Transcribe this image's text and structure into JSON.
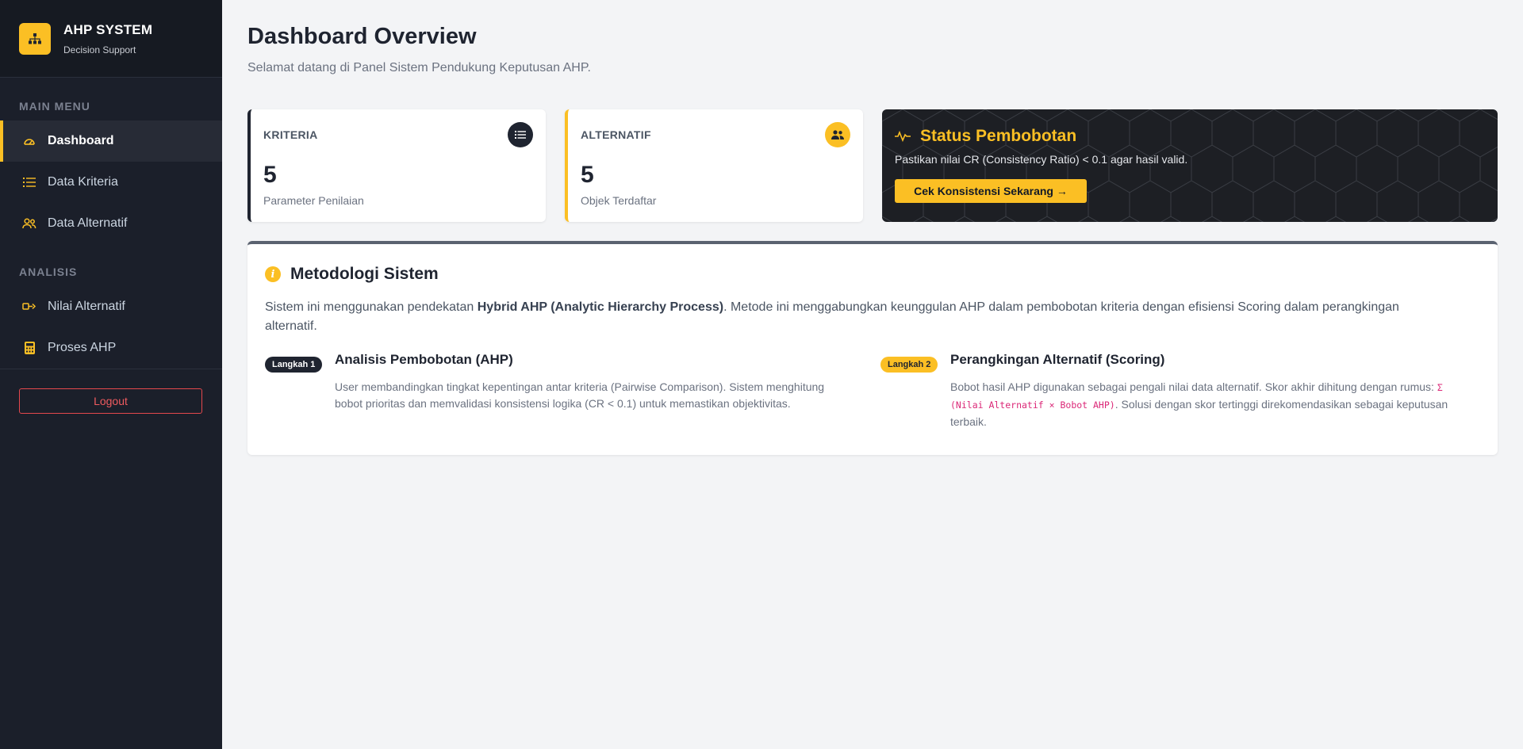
{
  "brand": {
    "title": "AHP SYSTEM",
    "subtitle": "Decision Support"
  },
  "sidebar": {
    "main_menu_heading": "MAIN MENU",
    "analysis_heading": "ANALISIS",
    "items": [
      {
        "label": "Dashboard",
        "icon": "gauge-icon",
        "active": true
      },
      {
        "label": "Data Kriteria",
        "icon": "list-icon",
        "active": false
      },
      {
        "label": "Data Alternatif",
        "icon": "users-icon",
        "active": false
      },
      {
        "label": "Nilai Alternatif",
        "icon": "scale-icon",
        "active": false
      },
      {
        "label": "Proses AHP",
        "icon": "calculator-icon",
        "active": false
      }
    ],
    "logout_label": "Logout"
  },
  "header": {
    "title": "Dashboard Overview",
    "subtitle": "Selamat datang di Panel Sistem Pendukung Keputusan AHP."
  },
  "cards": {
    "kriteria": {
      "label": "KRITERIA",
      "value": "5",
      "desc": "Parameter Penilaian",
      "icon": "list-icon"
    },
    "alternatif": {
      "label": "ALTERNATIF",
      "value": "5",
      "desc": "Objek Terdaftar",
      "icon": "users-icon"
    }
  },
  "status": {
    "title": "Status Pembobotan",
    "text": "Pastikan nilai CR (Consistency Ratio) < 0.1 agar hasil valid.",
    "button_label": "Cek Konsistensi Sekarang →",
    "icon": "pulse-icon"
  },
  "methodology": {
    "title": "Metodologi Sistem",
    "intro_before": "Sistem ini menggunakan pendekatan ",
    "intro_bold": "Hybrid AHP (Analytic Hierarchy Process)",
    "intro_after": ". Metode ini menggabungkan keunggulan AHP dalam pembobotan kriteria dengan efisiensi Scoring dalam perangkingan alternatif.",
    "steps": [
      {
        "badge": "Langkah 1",
        "title": "Analisis Pembobotan (AHP)",
        "desc": "User membandingkan tingkat kepentingan antar kriteria (Pairwise Comparison). Sistem menghitung bobot prioritas dan memvalidasi konsistensi logika (CR < 0.1) untuk memastikan objektivitas."
      },
      {
        "badge": "Langkah 2",
        "title": "Perangkingan Alternatif (Scoring)",
        "desc_before": "Bobot hasil AHP digunakan sebagai pengali nilai data alternatif. Skor akhir dihitung dengan rumus: ",
        "formula": "Σ (Nilai Alternatif × Bobot AHP)",
        "desc_after": ". Solusi dengan skor tertinggi direkomendasikan sebagai keputusan terbaik."
      }
    ]
  },
  "colors": {
    "accent": "#fbbf24",
    "sidebar_bg": "#1b1f2a",
    "danger": "#e5484d",
    "formula": "#db2777"
  }
}
